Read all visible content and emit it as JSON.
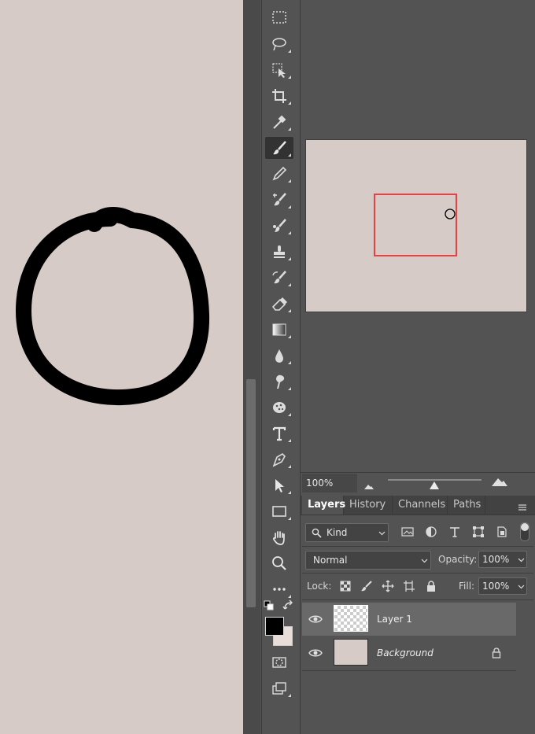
{
  "navigator": {
    "zoom_value": "100%"
  },
  "panel_tabs": [
    {
      "label": "Layers"
    },
    {
      "label": "History"
    },
    {
      "label": "Channels"
    },
    {
      "label": "Paths"
    }
  ],
  "layers_panel": {
    "filter_label": "Kind",
    "blend_mode": "Normal",
    "opacity_label": "Opacity:",
    "opacity_value": "100%",
    "lock_label": "Lock:",
    "fill_label": "Fill:",
    "fill_value": "100%",
    "layers": [
      {
        "name": "Layer 1",
        "selected": true
      },
      {
        "name": "Background",
        "selected": false,
        "locked": true
      }
    ]
  },
  "tools": [
    "marquee-tool",
    "lasso-tool",
    "object-selection-tool",
    "crop-tool",
    "eyedropper-tool",
    "brush-tool",
    "pencil-tool",
    "color-replacement-tool",
    "mixer-brush-tool",
    "clone-stamp-tool",
    "history-brush-tool",
    "eraser-tool",
    "gradient-tool",
    "blur-tool",
    "smudge-tool",
    "sponge-tool",
    "type-tool",
    "pen-tool",
    "path-selection-tool",
    "rectangle-tool",
    "hand-tool",
    "zoom-tool",
    "more-tools"
  ],
  "colors": {
    "canvas": "#d7cbc7",
    "foreground": "#000000",
    "background_swatch": "#e9ddd8",
    "nav_frame": "#e94141",
    "ui_bg": "#535353"
  }
}
